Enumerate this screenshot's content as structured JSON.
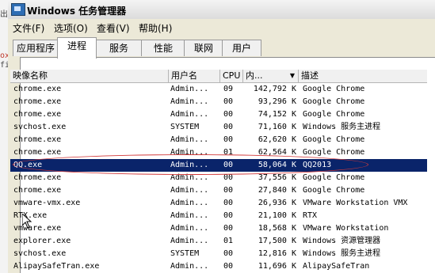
{
  "background": {
    "fragments": [
      "出",
      "ox",
      "标题",
      "fi"
    ]
  },
  "window": {
    "title": "Windows 任务管理器"
  },
  "menu": [
    "文件(F)",
    "选项(O)",
    "查看(V)",
    "帮助(H)"
  ],
  "tabs": [
    "应用程序",
    "进程",
    "服务",
    "性能",
    "联网",
    "用户"
  ],
  "active_tab": "进程",
  "columns": [
    "映像名称",
    "用户名",
    "CPU",
    "内...",
    "描述"
  ],
  "processes": [
    {
      "image": "chrome.exe",
      "user": "Admin...",
      "cpu": "09",
      "mem": "142,792 K",
      "desc": "Google Chrome"
    },
    {
      "image": "chrome.exe",
      "user": "Admin...",
      "cpu": "00",
      "mem": "93,296 K",
      "desc": "Google Chrome"
    },
    {
      "image": "chrome.exe",
      "user": "Admin...",
      "cpu": "00",
      "mem": "74,152 K",
      "desc": "Google Chrome"
    },
    {
      "image": "svchost.exe",
      "user": "SYSTEM",
      "cpu": "00",
      "mem": "71,160 K",
      "desc": "Windows 服务主进程"
    },
    {
      "image": "chrome.exe",
      "user": "Admin...",
      "cpu": "00",
      "mem": "62,620 K",
      "desc": "Google Chrome"
    },
    {
      "image": "chrome.exe",
      "user": "Admin...",
      "cpu": "01",
      "mem": "62,564 K",
      "desc": "Google Chrome"
    },
    {
      "image": "QQ.exe",
      "user": "Admin...",
      "cpu": "00",
      "mem": "58,064 K",
      "desc": "QQ2013"
    },
    {
      "image": "chrome.exe",
      "user": "Admin...",
      "cpu": "00",
      "mem": "37,556 K",
      "desc": "Google Chrome"
    },
    {
      "image": "chrome.exe",
      "user": "Admin...",
      "cpu": "00",
      "mem": "27,840 K",
      "desc": "Google Chrome"
    },
    {
      "image": "vmware-vmx.exe",
      "user": "Admin...",
      "cpu": "00",
      "mem": "26,936 K",
      "desc": "VMware Workstation VMX"
    },
    {
      "image": "RTX.exe",
      "user": "Admin...",
      "cpu": "00",
      "mem": "21,100 K",
      "desc": "RTX"
    },
    {
      "image": "vmware.exe",
      "user": "Admin...",
      "cpu": "00",
      "mem": "18,568 K",
      "desc": "VMware Workstation"
    },
    {
      "image": "explorer.exe",
      "user": "Admin...",
      "cpu": "01",
      "mem": "17,500 K",
      "desc": "Windows 资源管理器"
    },
    {
      "image": "svchost.exe",
      "user": "SYSTEM",
      "cpu": "00",
      "mem": "12,816 K",
      "desc": "Windows 服务主进程"
    },
    {
      "image": "AlipaySafeTran.exe",
      "user": "Admin...",
      "cpu": "00",
      "mem": "11,696 K",
      "desc": "AlipaySafeTran"
    }
  ],
  "selected_row_index": 6,
  "colors": {
    "selection": "#0a246a",
    "annotation": "#d23a3a"
  }
}
